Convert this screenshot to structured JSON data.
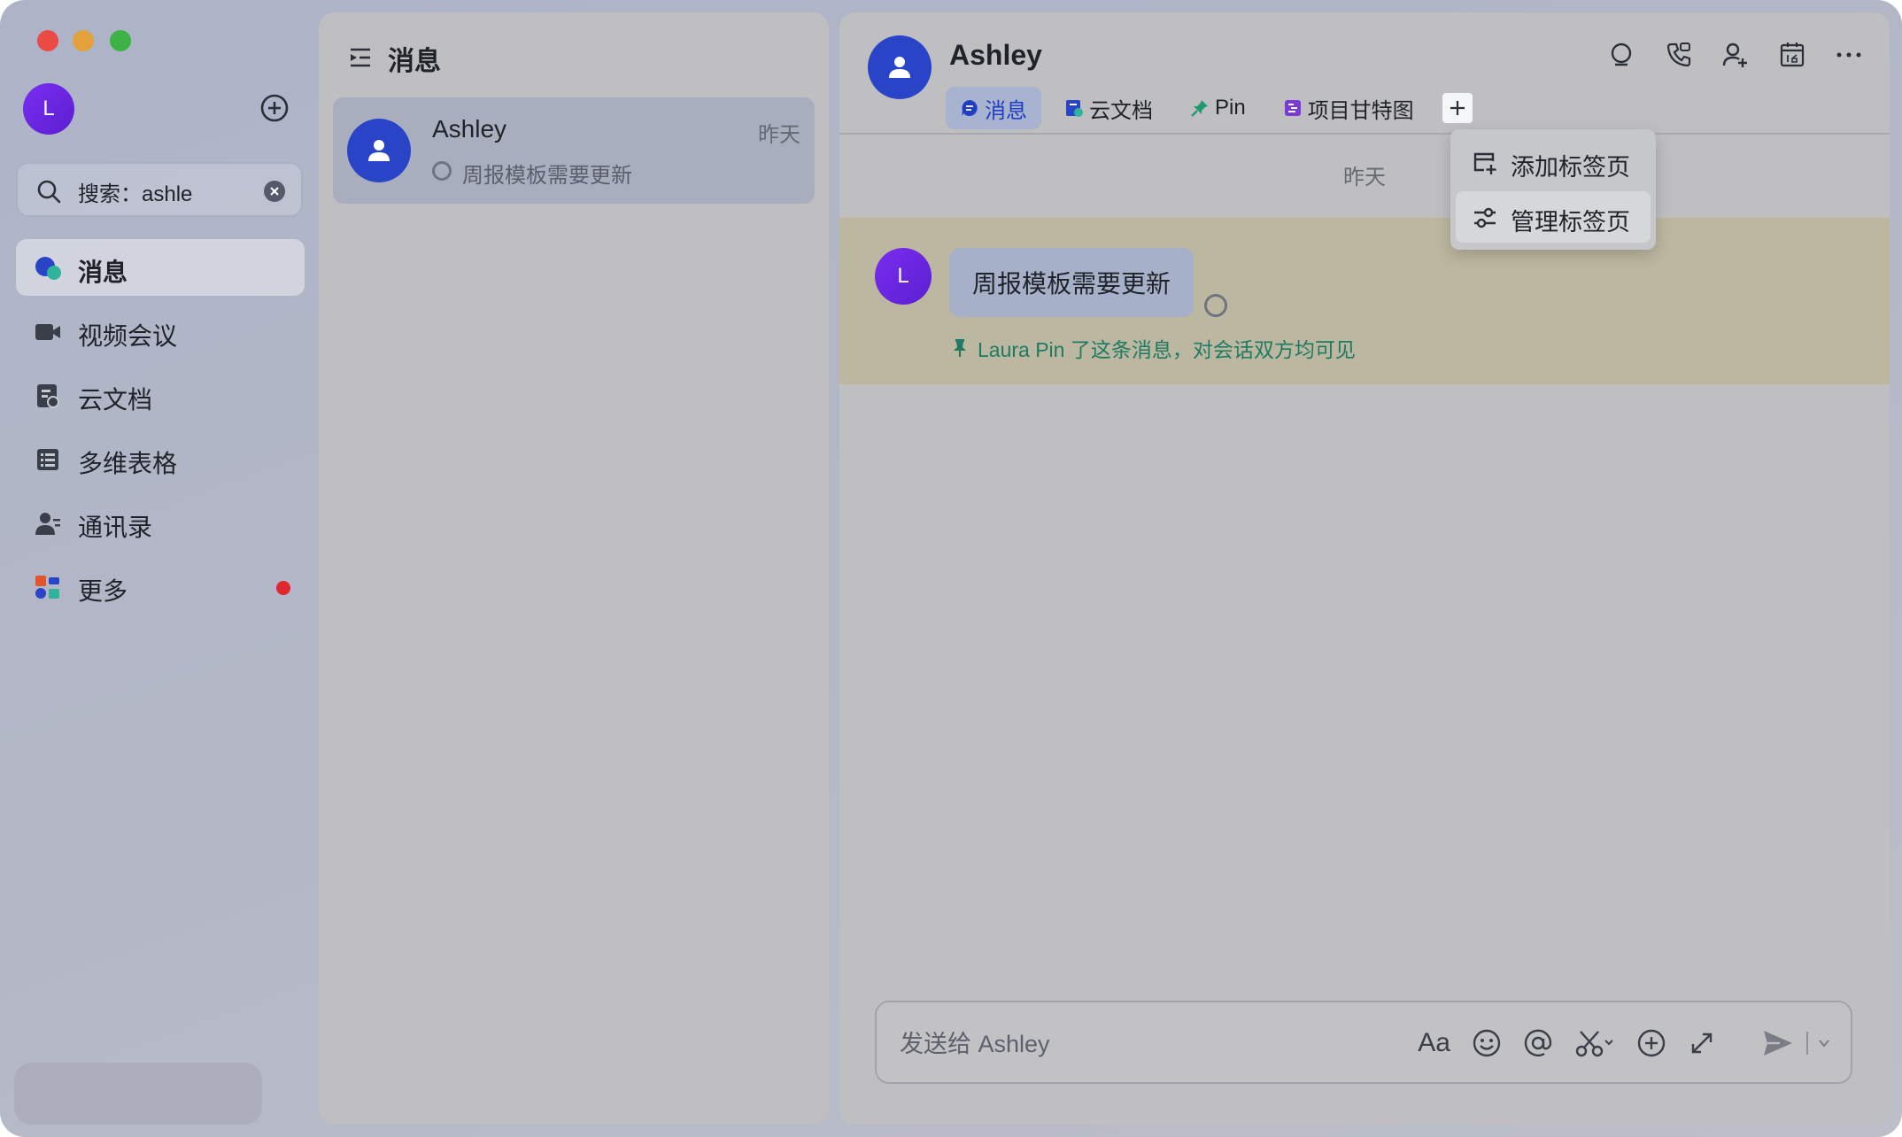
{
  "sidebar": {
    "avatar_letter": "L",
    "search": {
      "value": "搜索：ashle"
    },
    "items": [
      {
        "label": "消息",
        "icon": "chat-bubble-icon",
        "active": true
      },
      {
        "label": "视频会议",
        "icon": "video-camera-icon"
      },
      {
        "label": "云文档",
        "icon": "cloud-doc-icon"
      },
      {
        "label": "多维表格",
        "icon": "table-icon"
      },
      {
        "label": "通讯录",
        "icon": "contacts-icon"
      },
      {
        "label": "更多",
        "icon": "apps-grid-icon",
        "badge": "red-dot"
      }
    ]
  },
  "list": {
    "title": "消息",
    "conversation": {
      "name": "Ashley",
      "time": "昨天",
      "preview": "周报模板需要更新"
    }
  },
  "chat": {
    "name": "Ashley",
    "tabs": [
      {
        "label": "消息",
        "icon": "chat-bubble-icon",
        "active": true
      },
      {
        "label": "云文档",
        "icon": "doc-icon"
      },
      {
        "label": "Pin",
        "icon": "pin-icon"
      },
      {
        "label": "项目甘特图",
        "icon": "gantt-icon"
      }
    ],
    "date_separator": "昨天",
    "message": {
      "sender_initial": "L",
      "text": "周报模板需要更新",
      "pin_note": "Laura Pin 了这条消息，对会话双方均可见"
    },
    "composer": {
      "placeholder": "发送给 Ashley",
      "font_button": "Aa"
    }
  },
  "dropdown": {
    "items": [
      {
        "label": "添加标签页",
        "icon": "add-tab-icon"
      },
      {
        "label": "管理标签页",
        "icon": "sliders-icon",
        "highlighted": true
      }
    ]
  },
  "colors": {
    "accent": "#1f3ec4",
    "avatar_blue": "#2a44c8",
    "avatar_purple": "#6a24e0",
    "pin_green": "#1f7a62",
    "red_badge": "#e0262e"
  }
}
